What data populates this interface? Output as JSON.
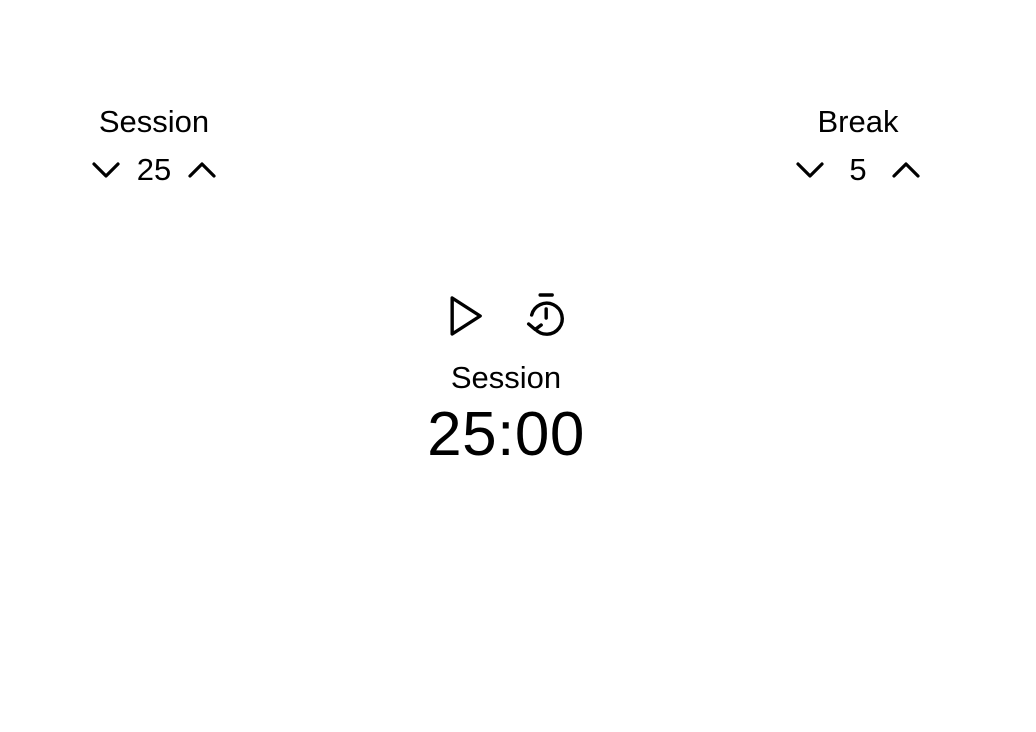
{
  "session": {
    "label": "Session",
    "value": "25",
    "decrement_icon": "chevron-down-icon",
    "increment_icon": "chevron-up-icon"
  },
  "break": {
    "label": "Break",
    "value": "5",
    "decrement_icon": "chevron-down-icon",
    "increment_icon": "chevron-up-icon"
  },
  "timer": {
    "play_icon": "play-icon",
    "reset_icon": "timer-reset-icon",
    "label": "Session",
    "time": "25:00"
  },
  "colors": {
    "background": "#ffffff",
    "foreground": "#000000"
  }
}
